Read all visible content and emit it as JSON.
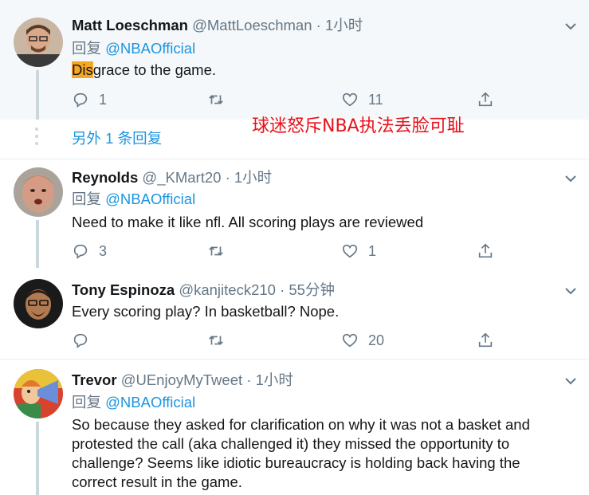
{
  "tweets": [
    {
      "name": "Matt Loeschman",
      "handle": "@MattLoeschman",
      "time": "· 1小时",
      "reply_prefix": "回复",
      "reply_mention": "@NBAOfficial",
      "text_highlight": "Dis",
      "text_rest": "grace to the game.",
      "replies": "1",
      "retweets": "",
      "likes": "11"
    },
    {
      "name": "Reynolds",
      "handle": "@_KMart20",
      "time": "· 1小时",
      "reply_prefix": "回复",
      "reply_mention": "@NBAOfficial",
      "text": "Need to make it like nfl. All scoring plays are reviewed",
      "replies": "3",
      "retweets": "",
      "likes": "1"
    },
    {
      "name": "Tony Espinoza",
      "handle": "@kanjiteck210",
      "time": "· 55分钟",
      "text": "Every scoring play? In basketball? Nope.",
      "replies": "",
      "retweets": "",
      "likes": "20"
    },
    {
      "name": "Trevor",
      "handle": "@UEnjoyMyTweet",
      "time": "· 1小时",
      "reply_prefix": "回复",
      "reply_mention": "@NBAOfficial",
      "text_lines": [
        "So because they asked for clarification on why it was not a basket and",
        "protested the call (aka challenged it) they missed the opportunity to",
        "challenge? Seems like idiotic bureaucracy is holding back having the",
        "correct result in the game."
      ]
    }
  ],
  "more_replies": "另外 1 条回复",
  "overlay_caption": "球迷怒斥NBA执法丢脸可耻",
  "icons": {
    "reply": "reply-icon",
    "retweet": "retweet-icon",
    "like": "heart-icon",
    "share": "share-icon",
    "caret": "chevron-down-icon"
  },
  "colors": {
    "link": "#1b95e0",
    "muted": "#657786",
    "highlight": "#f5a623",
    "caption": "#e8121b"
  }
}
